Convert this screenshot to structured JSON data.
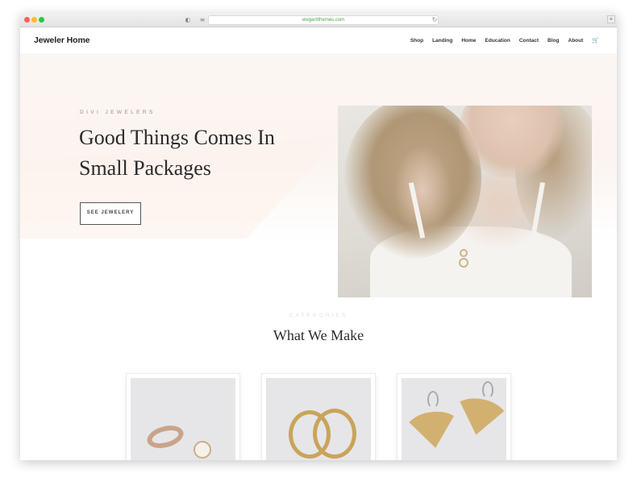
{
  "browser": {
    "url": "elegantthemes.com"
  },
  "header": {
    "logo": "Jeweler Home",
    "nav": [
      "Shop",
      "Landing",
      "Home",
      "Education",
      "Contact",
      "Blog",
      "About"
    ],
    "cart_icon": "cart-icon"
  },
  "hero": {
    "eyebrow": "DIVI JEWELERS",
    "title_line1": "Good Things Comes In",
    "title_line2": "Small Packages",
    "button_label": "SEE JEWELERY"
  },
  "categories": {
    "eyebrow": "CATEGORIES",
    "title": "What We Make"
  },
  "colors": {
    "accent_blush": "#fcf6f3",
    "text_dark": "#2b2b2b",
    "gold": "#c9a45a"
  }
}
